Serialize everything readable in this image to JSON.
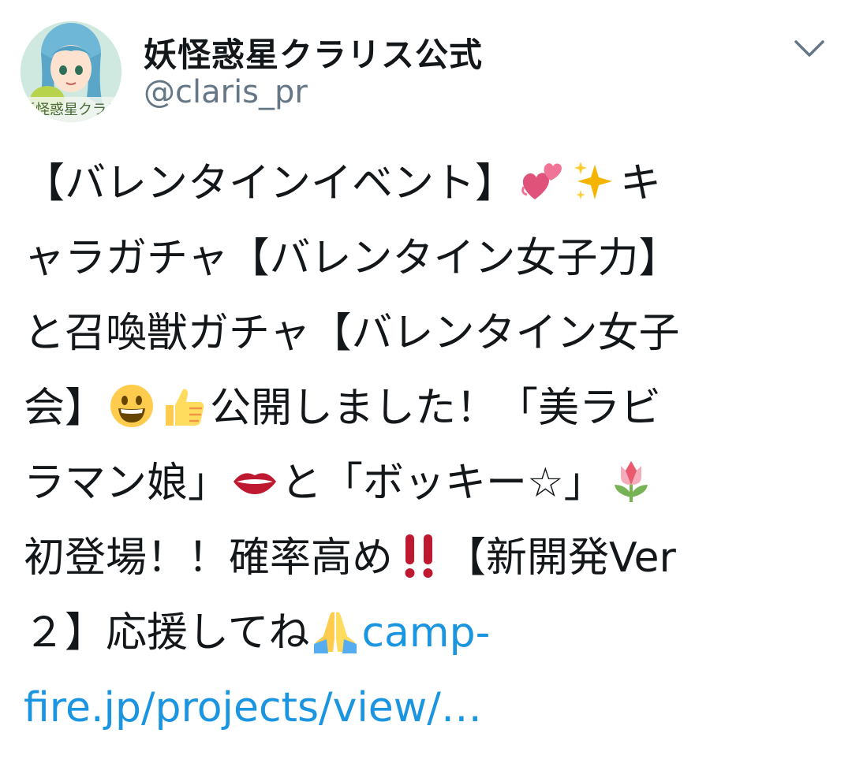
{
  "account": {
    "display_name": "妖怪惑星クラリス公式",
    "handle": "@claris_pr",
    "avatar_caption": "妖怪惑星クラリ"
  },
  "menu": {
    "icon": "chevron-down-icon"
  },
  "tweet": {
    "line1_a": "【バレンタインイベント】",
    "line1_b": "キ",
    "line2": "ャラガチャ【バレンタイン女子力】",
    "line3": "と召喚獣ガチャ【バレンタイン女子",
    "line4_a": "会】",
    "line4_b": "公開しました！「美ラビ",
    "line5_a": "ラマン娘」",
    "line5_b": "と「ボッキー☆」",
    "line6_a": "初登場！！確率高め",
    "line6_b": "【新開発Ver",
    "line7_a": "２】応援してね",
    "link_part1": "camp-",
    "link_part2": "fire.jp/projects/view/…"
  },
  "emojis": [
    "two-hearts-icon",
    "sparkles-icon",
    "grinning-face-icon",
    "thumbs-up-icon",
    "lips-icon",
    "tulip-icon",
    "double-exclamation-icon",
    "folded-hands-icon"
  ],
  "colors": {
    "link": "#1b95e0",
    "handle": "#657786",
    "text": "#14171a"
  }
}
